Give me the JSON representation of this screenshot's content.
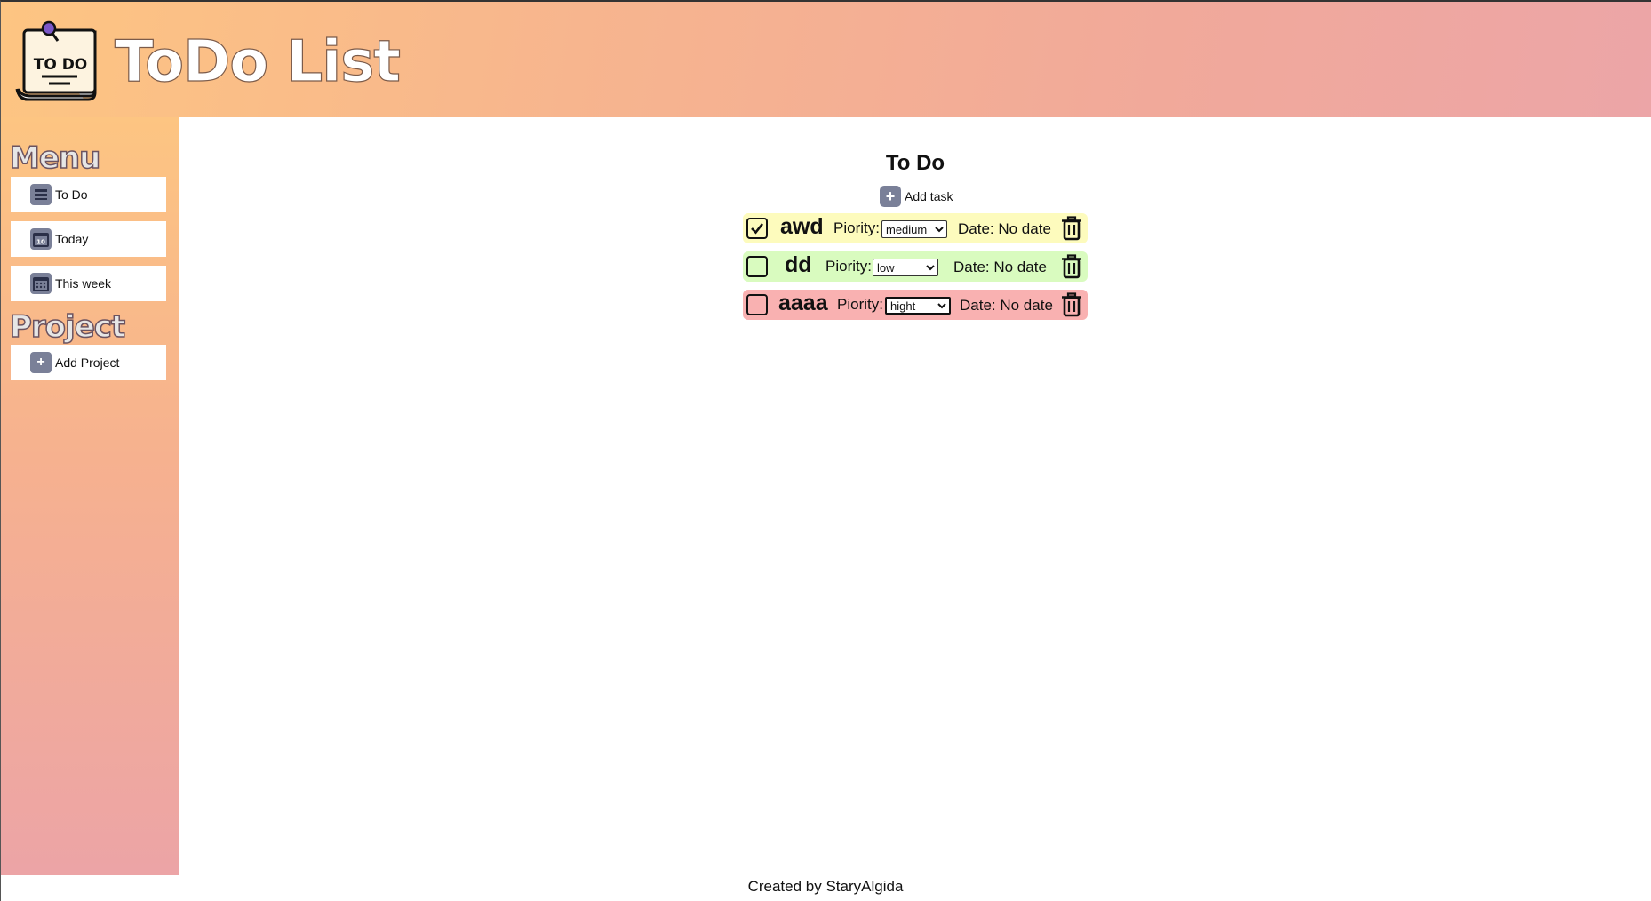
{
  "header": {
    "logo_text": "TO DO",
    "title": "ToDo List"
  },
  "sidebar": {
    "menu_heading": "Menu",
    "items": [
      {
        "label": "To Do",
        "icon": "inbox-icon"
      },
      {
        "label": "Today",
        "icon": "calendar-day-icon"
      },
      {
        "label": "This week",
        "icon": "calendar-week-icon"
      }
    ],
    "project_heading": "Project",
    "add_project_label": "Add Project"
  },
  "main": {
    "title": "To Do",
    "add_task_label": "Add task",
    "tasks": [
      {
        "name": "awd",
        "checked": true,
        "priority_label": "Piority:",
        "priority": "medium",
        "date_text": "Date: No date",
        "bg": "#fdfbbd"
      },
      {
        "name": "dd",
        "checked": false,
        "priority_label": "Piority:",
        "priority": "low",
        "date_text": "Date: No date",
        "bg": "#d9fbbf"
      },
      {
        "name": "aaaa",
        "checked": false,
        "priority_label": "Piority:",
        "priority": "hight",
        "date_text": "Date: No date",
        "bg": "#f9b1b1"
      }
    ]
  },
  "footer": {
    "text": "Created by StaryAlgida"
  },
  "colors": {
    "icon_bg": "#7a8098",
    "medium": "#fdfbbd",
    "low": "#d9fbbf",
    "high": "#f9b1b1"
  }
}
